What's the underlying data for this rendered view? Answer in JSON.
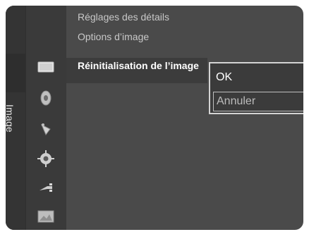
{
  "sidebar": {
    "tab_label": "Image",
    "icons": [
      {
        "name": "picture-icon",
        "active": true
      },
      {
        "name": "sound-icon",
        "active": false
      },
      {
        "name": "satellite-icon",
        "active": false
      },
      {
        "name": "setup-gear-icon",
        "active": false
      },
      {
        "name": "input-plug-icon",
        "active": false
      },
      {
        "name": "application-icon",
        "active": false
      }
    ]
  },
  "menu": {
    "items": [
      {
        "label": "Réglages des détails"
      },
      {
        "label": "Options d’image"
      },
      {
        "label": "Réinitialisation de l’image"
      }
    ],
    "selected_index": 2
  },
  "popup": {
    "options": [
      "OK",
      "Annuler"
    ],
    "focused": "Annuler"
  }
}
